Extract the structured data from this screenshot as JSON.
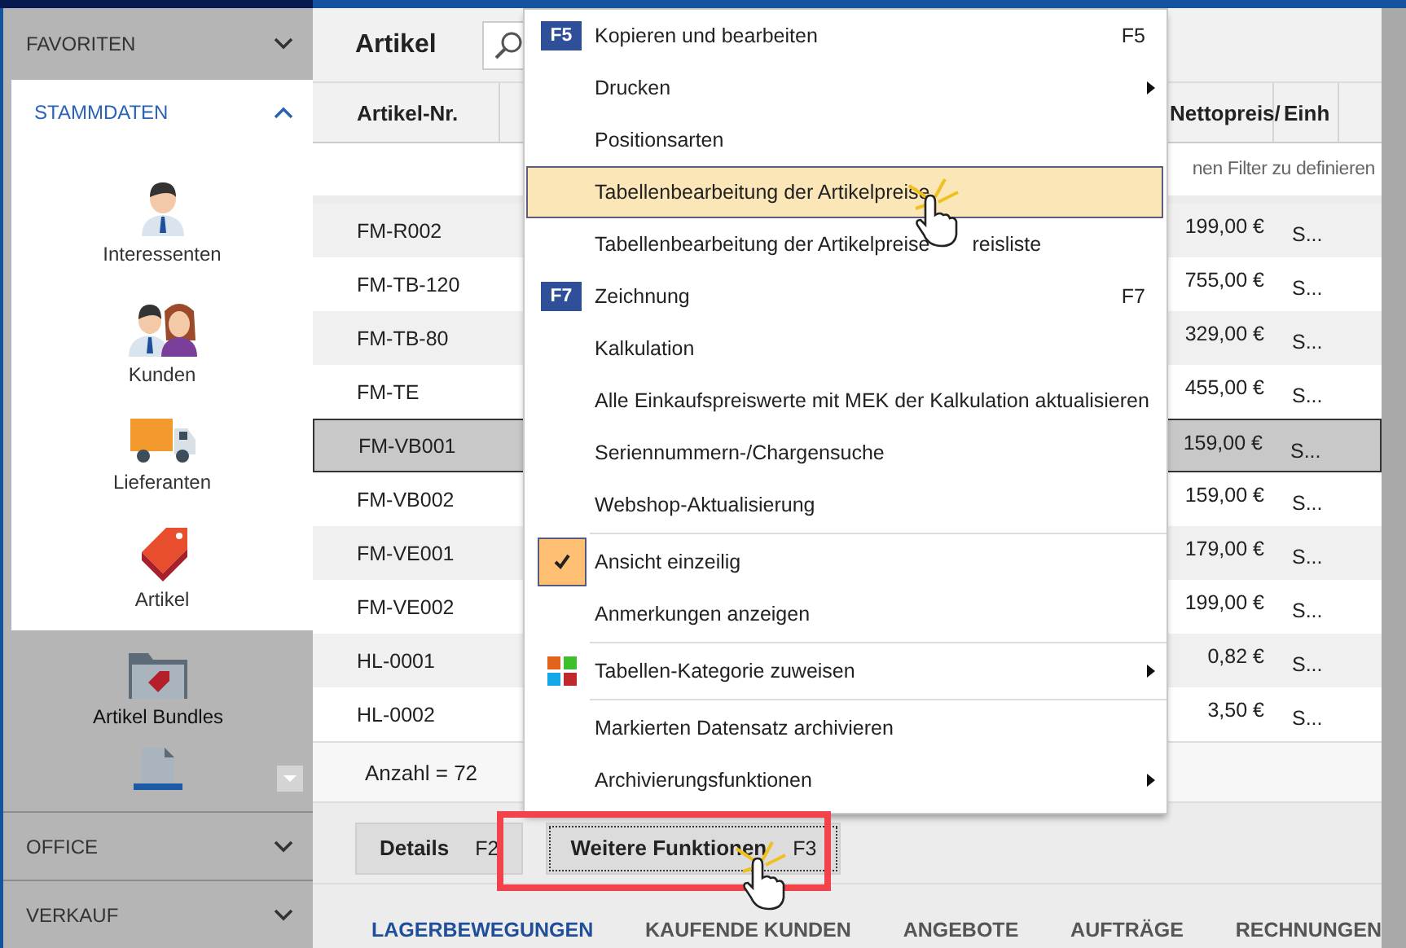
{
  "sidebar": {
    "sections_top": [
      {
        "title": "FAVORITEN",
        "expanded": false
      }
    ],
    "active_section": {
      "title": "STAMMDATEN",
      "expanded": true,
      "items": [
        {
          "label": "Interessenten",
          "kind": "person"
        },
        {
          "label": "Kunden",
          "kind": "people"
        },
        {
          "label": "Lieferanten",
          "kind": "truck"
        },
        {
          "label": "Artikel",
          "kind": "tag"
        }
      ],
      "more_items": [
        {
          "label": "Artikel Bundles",
          "kind": "folder"
        },
        {
          "kind": "document"
        }
      ]
    },
    "sections_bottom": [
      {
        "title": "OFFICE",
        "expanded": false
      },
      {
        "title": "VERKAUF",
        "expanded": false
      }
    ]
  },
  "header": {
    "title": "Artikel"
  },
  "table": {
    "columns": [
      "Artikel-Nr.",
      "Nettopreis/",
      "Einh"
    ],
    "filter_placeholder": "nen Filter zu definieren",
    "rows": [
      {
        "nr": "FM-R002",
        "price": "199,00 €",
        "unit": "S...",
        "selected": false
      },
      {
        "nr": "FM-TB-120",
        "price": "755,00 €",
        "unit": "S...",
        "selected": false
      },
      {
        "nr": "FM-TB-80",
        "price": "329,00 €",
        "unit": "S...",
        "selected": false
      },
      {
        "nr": "FM-TE",
        "price": "455,00 €",
        "unit": "S...",
        "selected": false
      },
      {
        "nr": "FM-VB001",
        "price": "159,00 €",
        "unit": "S...",
        "selected": true
      },
      {
        "nr": "FM-VB002",
        "price": "159,00 €",
        "unit": "S...",
        "selected": false
      },
      {
        "nr": "FM-VE001",
        "price": "179,00 €",
        "unit": "S...",
        "selected": false
      },
      {
        "nr": "FM-VE002",
        "price": "199,00 €",
        "unit": "S...",
        "selected": false
      },
      {
        "nr": "HL-0001",
        "price": "0,82 €",
        "unit": "S...",
        "selected": false
      },
      {
        "nr": "HL-0002",
        "price": "3,50 €",
        "unit": "S...",
        "selected": false
      }
    ],
    "count": "Anzahl = 72"
  },
  "buttons": [
    {
      "label": "Details",
      "shortcut": "F2",
      "highlighted": false
    },
    {
      "label": "Weitere Funktionen",
      "shortcut": "F3",
      "highlighted": true
    }
  ],
  "bottom_tabs": [
    {
      "label": "LAGERBEWEGUNGEN",
      "selected": true
    },
    {
      "label": "KAUFENDE KUNDEN",
      "selected": false
    },
    {
      "label": "ANGEBOTE",
      "selected": false
    },
    {
      "label": "AUFTRÄGE",
      "selected": false
    },
    {
      "label": "RECHNUNGEN",
      "selected": false
    }
  ],
  "context_menu": {
    "items": [
      {
        "kind": "item",
        "badge": "F5",
        "label": "Kopieren und bearbeiten",
        "shortcut": "F5",
        "selected": false
      },
      {
        "kind": "submenu",
        "label": "Drucken",
        "selected": false
      },
      {
        "kind": "item",
        "label": "Positionsarten",
        "selected": false
      },
      {
        "kind": "item",
        "label": "Tabellenbearbeitung der Artikelpreise",
        "selected": true
      },
      {
        "kind": "item",
        "label": "Tabellenbearbeitung der Artikelpreise",
        "label_end": "reisliste",
        "selected": false
      },
      {
        "kind": "item",
        "badge": "F7",
        "label": "Zeichnung",
        "shortcut": "F7",
        "selected": false
      },
      {
        "kind": "item",
        "label": "Kalkulation",
        "selected": false
      },
      {
        "kind": "item",
        "label": "Alle Einkaufspreiswerte mit MEK der Kalkulation aktualisieren",
        "selected": false
      },
      {
        "kind": "item",
        "label": "Seriennummern-/Chargensuche",
        "selected": false
      },
      {
        "kind": "item",
        "label": "Webshop-Aktualisierung",
        "selected": false
      },
      {
        "kind": "separator"
      },
      {
        "kind": "check",
        "label": "Ansicht einzeilig",
        "checked": true,
        "selected": false
      },
      {
        "kind": "check",
        "label": "Anmerkungen anzeigen",
        "checked": false,
        "selected": false
      },
      {
        "kind": "separator"
      },
      {
        "kind": "category",
        "label": "Tabellen-Kategorie zuweisen",
        "selected": false
      },
      {
        "kind": "separator"
      },
      {
        "kind": "item",
        "label": "Markierten Datensatz archivieren",
        "selected": false
      },
      {
        "kind": "submenu",
        "label": "Archivierungsfunktionen",
        "selected": false
      }
    ]
  }
}
